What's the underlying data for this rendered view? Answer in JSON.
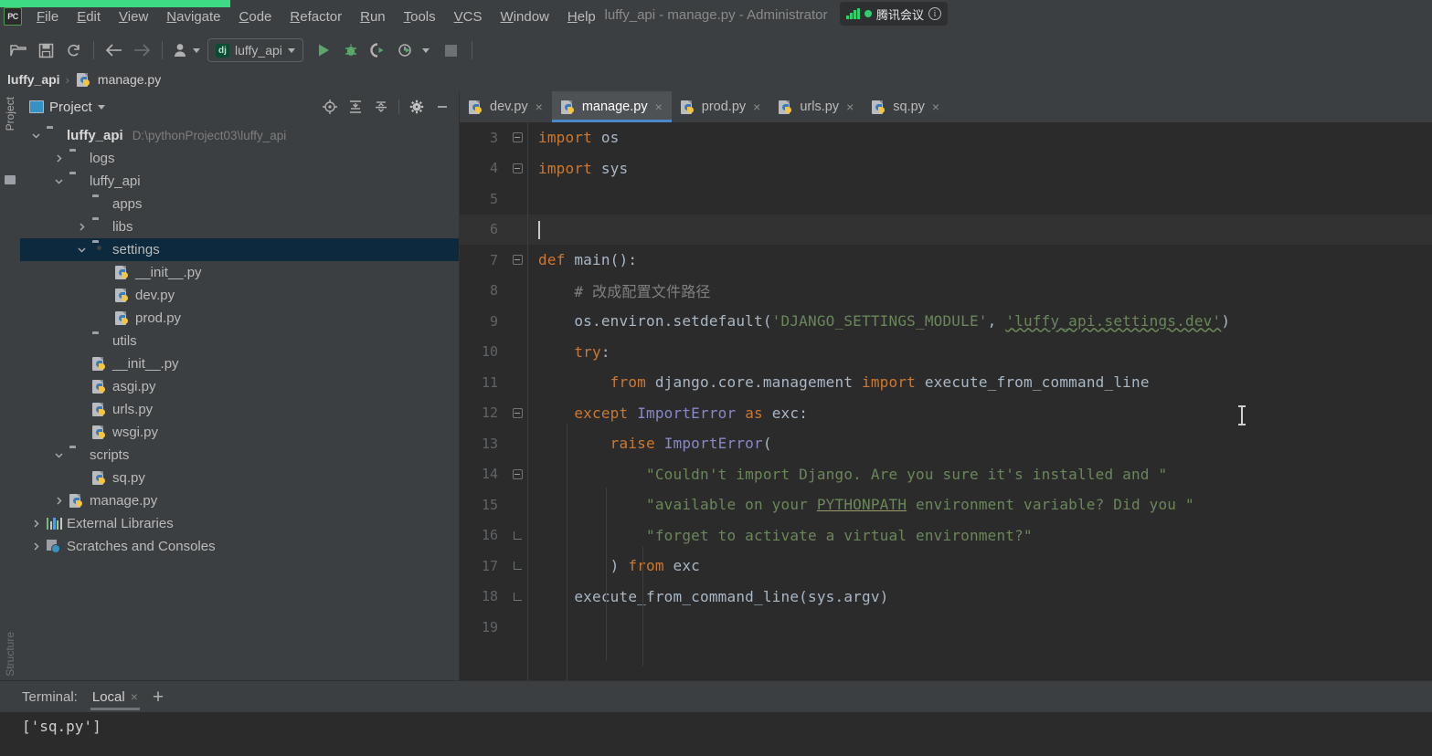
{
  "window": {
    "title": "luffy_api - manage.py - Administrator",
    "logo_text": "PC"
  },
  "overlay": {
    "name": "tencent-meeting-widget",
    "label": "腾讯会议",
    "info_glyph": "i",
    "dot_color": "#2fcf6f"
  },
  "menubar": {
    "items": [
      {
        "label": "File"
      },
      {
        "label": "Edit"
      },
      {
        "label": "View"
      },
      {
        "label": "Navigate"
      },
      {
        "label": "Code"
      },
      {
        "label": "Refactor"
      },
      {
        "label": "Run"
      },
      {
        "label": "Tools"
      },
      {
        "label": "VCS"
      },
      {
        "label": "Window"
      },
      {
        "label": "Help"
      }
    ]
  },
  "toolbar": {
    "run_config": {
      "label": "luffy_api",
      "icon": "django-icon",
      "badge": "dj"
    },
    "buttons": [
      {
        "name": "open-project-icon"
      },
      {
        "name": "save-all-icon"
      },
      {
        "name": "sync-icon"
      },
      {
        "name": "back-icon"
      },
      {
        "name": "forward-icon"
      },
      {
        "name": "user-avatar-icon"
      },
      {
        "name": "run-icon"
      },
      {
        "name": "debug-icon"
      },
      {
        "name": "run-coverage-icon"
      },
      {
        "name": "profile-icon"
      },
      {
        "name": "stop-icon"
      }
    ]
  },
  "breadcrumb": {
    "project": "luffy_api",
    "separator": "›",
    "file": "manage.py"
  },
  "sidebar_strips": {
    "project_label": "Project",
    "structure_label": "Structure"
  },
  "project_panel": {
    "title": "Project",
    "tools": [
      "locate-icon",
      "expand-all-icon",
      "collapse-all-icon",
      "settings-gear-icon",
      "minimize-icon"
    ],
    "tree": [
      {
        "label": "luffy_api",
        "path": "D:\\pythonProject03\\luffy_api",
        "icon": "folder",
        "indent": 0,
        "arrow": "down",
        "bold": true,
        "selected": false
      },
      {
        "label": "logs",
        "icon": "folder-module",
        "indent": 1,
        "arrow": "right",
        "selected": false
      },
      {
        "label": "luffy_api",
        "icon": "folder-module",
        "indent": 1,
        "arrow": "down",
        "selected": false
      },
      {
        "label": "apps",
        "icon": "folder",
        "indent": 2,
        "arrow": "none",
        "selected": false
      },
      {
        "label": "libs",
        "icon": "folder-module",
        "indent": 2,
        "arrow": "right",
        "selected": false
      },
      {
        "label": "settings",
        "icon": "folder-module",
        "indent": 2,
        "arrow": "down",
        "selected": true
      },
      {
        "label": "__init__.py",
        "icon": "python-file",
        "indent": 3,
        "arrow": "none",
        "selected": false
      },
      {
        "label": "dev.py",
        "icon": "python-file",
        "indent": 3,
        "arrow": "none",
        "selected": false
      },
      {
        "label": "prod.py",
        "icon": "python-file",
        "indent": 3,
        "arrow": "none",
        "selected": false
      },
      {
        "label": "utils",
        "icon": "folder",
        "indent": 2,
        "arrow": "none",
        "selected": false
      },
      {
        "label": "__init__.py",
        "icon": "python-file",
        "indent": 2,
        "arrow": "none",
        "selected": false
      },
      {
        "label": "asgi.py",
        "icon": "python-file",
        "indent": 2,
        "arrow": "none",
        "selected": false
      },
      {
        "label": "urls.py",
        "icon": "python-file",
        "indent": 2,
        "arrow": "none",
        "selected": false
      },
      {
        "label": "wsgi.py",
        "icon": "python-file",
        "indent": 2,
        "arrow": "none",
        "selected": false
      },
      {
        "label": "scripts",
        "icon": "folder",
        "indent": 1,
        "arrow": "down",
        "selected": false
      },
      {
        "label": "sq.py",
        "icon": "python-file",
        "indent": 2,
        "arrow": "none",
        "selected": false
      },
      {
        "label": "manage.py",
        "icon": "python-file",
        "indent": 1,
        "arrow": "right",
        "selected": false
      },
      {
        "label": "External Libraries",
        "icon": "library-icon",
        "indent": 0,
        "arrow": "right",
        "selected": false
      },
      {
        "label": "Scratches and Consoles",
        "icon": "scratches-icon",
        "indent": 0,
        "arrow": "right",
        "selected": false
      }
    ]
  },
  "editor": {
    "tabs": [
      {
        "label": "dev.py",
        "active": false
      },
      {
        "label": "manage.py",
        "active": true
      },
      {
        "label": "prod.py",
        "active": false
      },
      {
        "label": "urls.py",
        "active": false
      },
      {
        "label": "sq.py",
        "active": false
      }
    ],
    "close_glyph": "×",
    "first_line_number": 3,
    "cursor_line": 6,
    "lines": [
      {
        "n": 3,
        "fold": "minus",
        "text": "import os"
      },
      {
        "n": 4,
        "fold": "minus",
        "text": "import sys"
      },
      {
        "n": 5,
        "fold": "none",
        "text": ""
      },
      {
        "n": 6,
        "fold": "none",
        "text": ""
      },
      {
        "n": 7,
        "fold": "minus",
        "text": "def main():"
      },
      {
        "n": 8,
        "fold": "none",
        "text": "    # 改成配置文件路径"
      },
      {
        "n": 9,
        "fold": "none",
        "text": "    os.environ.setdefault('DJANGO_SETTINGS_MODULE', 'luffy_api.settings.dev')"
      },
      {
        "n": 10,
        "fold": "none",
        "text": "    try:"
      },
      {
        "n": 11,
        "fold": "none",
        "text": "        from django.core.management import execute_from_command_line"
      },
      {
        "n": 12,
        "fold": "minus",
        "text": "    except ImportError as exc:"
      },
      {
        "n": 13,
        "fold": "none",
        "text": "        raise ImportError("
      },
      {
        "n": 14,
        "fold": "minus",
        "text": "            \"Couldn't import Django. Are you sure it's installed and \""
      },
      {
        "n": 15,
        "fold": "none",
        "text": "            \"available on your PYTHONPATH environment variable? Did you \""
      },
      {
        "n": 16,
        "fold": "bracket",
        "text": "            \"forget to activate a virtual environment?\""
      },
      {
        "n": 17,
        "fold": "bracket",
        "text": "        ) from exc"
      },
      {
        "n": 18,
        "fold": "bracket",
        "text": "    execute_from_command_line(sys.argv)"
      },
      {
        "n": 19,
        "fold": "none",
        "text": ""
      }
    ]
  },
  "terminal": {
    "title": "Terminal:",
    "tab_label": "Local",
    "close_glyph": "×",
    "add_glyph": "+",
    "output": "['sq.py']"
  },
  "colors": {
    "accent_blue": "#4a88c7",
    "selection": "#0d293e",
    "editor_bg": "#2b2b2b",
    "panel_bg": "#3c3f41",
    "keyword": "#cc7832",
    "string": "#6a8759",
    "comment": "#808080",
    "exception": "#8888c6",
    "share_green": "#3ddc84"
  }
}
